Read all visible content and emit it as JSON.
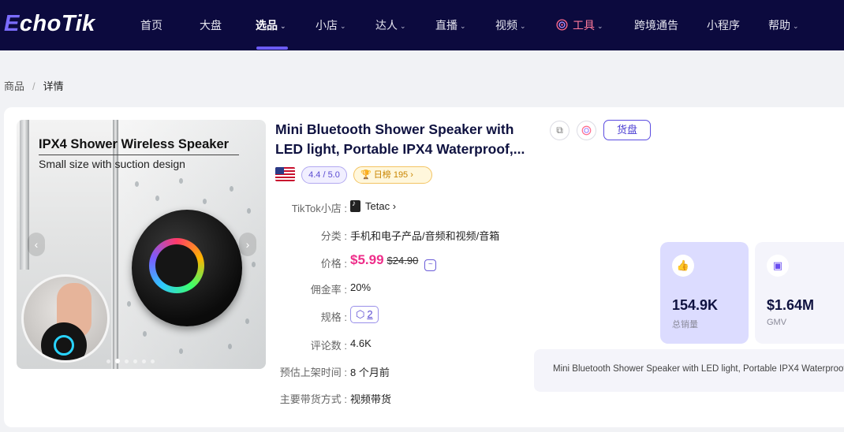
{
  "nav": {
    "logo_prefix": "E",
    "logo_rest": "choTik",
    "items": [
      {
        "label": "首页",
        "dropdown": false
      },
      {
        "label": "大盘",
        "dropdown": false
      },
      {
        "label": "选品",
        "dropdown": true
      },
      {
        "label": "小店",
        "dropdown": true
      },
      {
        "label": "达人",
        "dropdown": true
      },
      {
        "label": "直播",
        "dropdown": true
      },
      {
        "label": "视频",
        "dropdown": true
      },
      {
        "label": "工具",
        "dropdown": true
      },
      {
        "label": "跨境通告",
        "dropdown": false
      },
      {
        "label": "小程序",
        "dropdown": false
      },
      {
        "label": "帮助",
        "dropdown": true
      }
    ],
    "active": "选品"
  },
  "breadcrumb": {
    "parent": "商品",
    "sep": "/",
    "current": "详情"
  },
  "product": {
    "image_headline": "IPX4 Shower Wireless Speaker",
    "image_subline": "Small size with suction design",
    "title_line1": "Mini Bluetooth Shower Speaker with",
    "title_line2": "LED light, Portable IPX4 Waterproof,...",
    "rating": "4.4 / 5.0",
    "rank_label": "日榜 195",
    "huopan_label": "货盘",
    "fields": {
      "shop_label": "TikTok小店 :",
      "shop_value": "Tetac",
      "category_label": "分类 :",
      "category_value": "手机和电子产品/音频和视频/音箱",
      "price_label": "价格 :",
      "price_now": "$5.99",
      "price_old": "$24.90",
      "commission_label": "佣金率 :",
      "commission_value": "20%",
      "spec_label": "规格 :",
      "spec_count": "2",
      "reviews_label": "评论数 :",
      "reviews_value": "4.6K",
      "listed_label": "预估上架时间 :",
      "listed_value": "8 个月前",
      "mode_label": "主要带货方式 :",
      "mode_value": "视频带货"
    },
    "stats": [
      {
        "value": "154.9K",
        "label": "总销量"
      },
      {
        "value": "$1.64M",
        "label": "GMV"
      }
    ],
    "description": "Mini Bluetooth Shower Speaker with LED light, Portable IPX4 Waterproof"
  }
}
